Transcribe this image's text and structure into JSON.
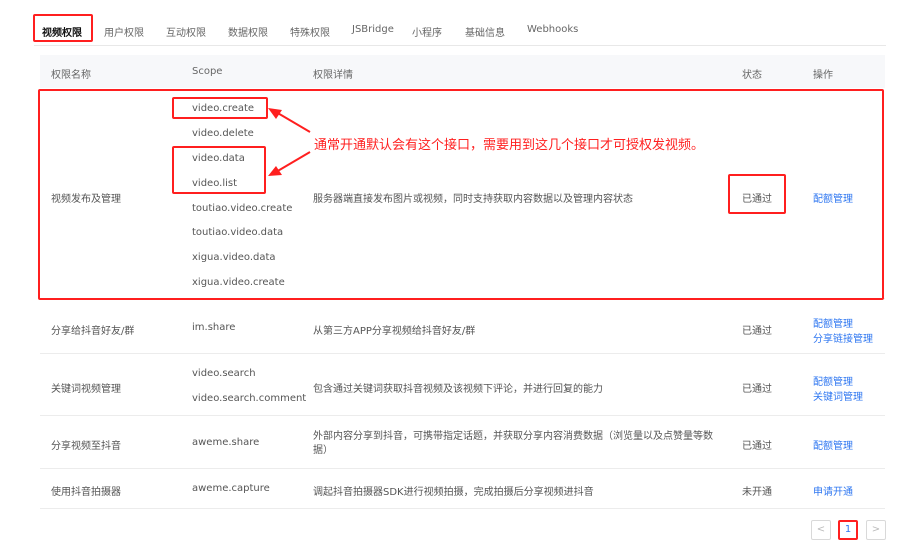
{
  "tabs": [
    "视频权限",
    "用户权限",
    "互动权限",
    "数据权限",
    "特殊权限",
    "JSBridge",
    "小程序",
    "基础信息",
    "Webhooks"
  ],
  "table": {
    "headers": {
      "name": "权限名称",
      "scope": "Scope",
      "detail": "权限详情",
      "status": "状态",
      "action": "操作"
    },
    "rows": [
      {
        "name": "视频发布及管理",
        "scopes": [
          "video.create",
          "video.delete",
          "video.data",
          "video.list",
          "toutiao.video.create",
          "toutiao.video.data",
          "xigua.video.data",
          "xigua.video.create"
        ],
        "detail": "服务器端直接发布图片或视频，同时支持获取内容数据以及管理内容状态",
        "status": "已通过",
        "actions": [
          "配额管理"
        ]
      },
      {
        "name": "分享给抖音好友/群",
        "scopes": [
          "im.share"
        ],
        "detail": "从第三方APP分享视频给抖音好友/群",
        "status": "已通过",
        "actions": [
          "配额管理",
          "分享链接管理"
        ]
      },
      {
        "name": "关键词视频管理",
        "scopes": [
          "video.search",
          "video.search.comment"
        ],
        "detail": "包含通过关键词获取抖音视频及该视频下评论，并进行回复的能力",
        "status": "已通过",
        "actions": [
          "配额管理",
          "关键词管理"
        ]
      },
      {
        "name": "分享视频至抖音",
        "scopes": [
          "aweme.share"
        ],
        "detail": "外部内容分享到抖音，可携带指定话题，并获取分享内容消费数据（浏览量以及点赞量等数据）",
        "status": "已通过",
        "actions": [
          "配额管理"
        ]
      },
      {
        "name": "使用抖音拍摄器",
        "scopes": [
          "aweme.capture"
        ],
        "detail": "调起抖音拍摄器SDK进行视频拍摄，完成拍摄后分享视频进抖音",
        "status": "未开通",
        "actions": [
          "申请开通"
        ]
      }
    ]
  },
  "annotation": "通常开通默认会有这个接口，需要用到这几个接口才可授权发视频。",
  "pagination": {
    "prev": "<",
    "current": "1",
    "next": ">"
  },
  "colors": {
    "accent": "#2f77f1",
    "annotation": "#ff1f1f"
  }
}
